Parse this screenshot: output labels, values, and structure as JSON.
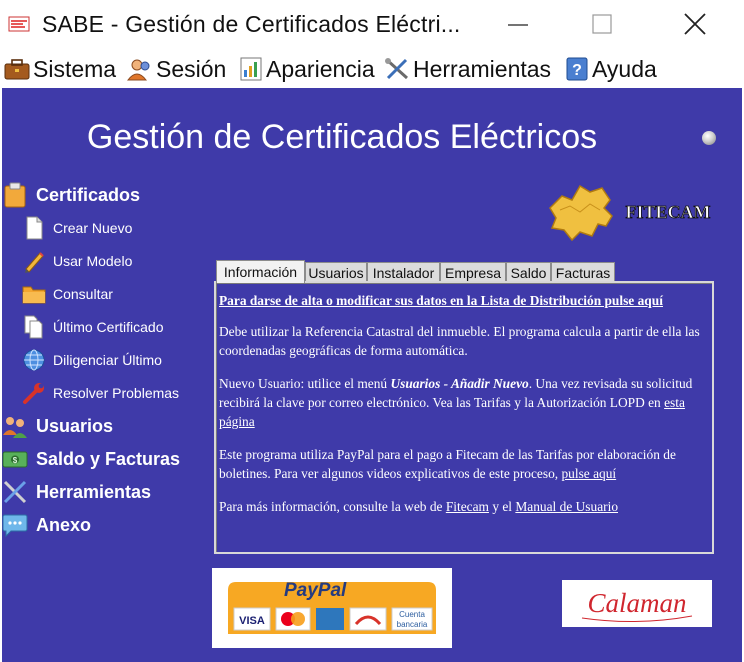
{
  "window": {
    "title": "SABE - Gestión de Certificados Eléctri..."
  },
  "menu": [
    {
      "label": "Sistema",
      "icon": "briefcase-icon"
    },
    {
      "label": "Sesión",
      "icon": "user-icon"
    },
    {
      "label": "Apariencia",
      "icon": "chart-icon"
    },
    {
      "label": "Herramientas",
      "icon": "tools-icon"
    },
    {
      "label": "Ayuda",
      "icon": "help-icon"
    }
  ],
  "main": {
    "heading": "Gestión de Certificados Eléctricos",
    "sidebar": {
      "certificados": {
        "label": "Certificados",
        "items": [
          {
            "label": "Crear Nuevo",
            "icon": "new-document-icon"
          },
          {
            "label": "Usar Modelo",
            "icon": "pencil-icon"
          },
          {
            "label": "Consultar",
            "icon": "folder-icon"
          },
          {
            "label": "Último Certificado",
            "icon": "documents-icon"
          },
          {
            "label": "Diligenciar Último",
            "icon": "globe-icon"
          },
          {
            "label": "Resolver Problemas",
            "icon": "wrench-icon"
          }
        ]
      },
      "usuarios": {
        "label": "Usuarios"
      },
      "saldo": {
        "label": "Saldo y Facturas"
      },
      "herramientas": {
        "label": "Herramientas"
      },
      "anexo": {
        "label": "Anexo"
      }
    },
    "logo_text": "FITECAM",
    "tabs": [
      "Información",
      "Usuarios",
      "Instalador",
      "Empresa",
      "Saldo",
      "Facturas"
    ],
    "info": {
      "lead": "Para darse de alta o modificar sus datos en la Lista de Distribución pulse aquí",
      "p1": "Debe utilizar la Referencia Catastral del inmueble. El programa calcula a partir de ella las coordenadas geográficas de forma automática.",
      "p2_a": "Nuevo Usuario: utilice el menú ",
      "p2_b": "Usuarios - Añadir Nuevo",
      "p2_c": ". Una vez revisada su solicitud recibirá la clave por correo electrónico. Vea las Tarifas y la Autorización LOPD en ",
      "p2_link": "esta página",
      "p3_a": "Este programa utiliza PayPal para el pago a Fitecam de las Tarifas por elaboración de boletines. Para ver algunos videos explicativos de este proceso, ",
      "p3_link": "pulse aquí",
      "p4_a": "Para más información, consulte la web de ",
      "p4_link1": "Fitecam",
      "p4_b": " y el ",
      "p4_link2": "Manual de Usuario"
    },
    "paypal": {
      "brand": "PayPal",
      "cards": [
        "VISA",
        "MasterCard",
        "AMEX",
        "Aurora"
      ],
      "bank_line1": "Cuenta",
      "bank_line2": "bancaria"
    },
    "calaman": "Calaman"
  }
}
